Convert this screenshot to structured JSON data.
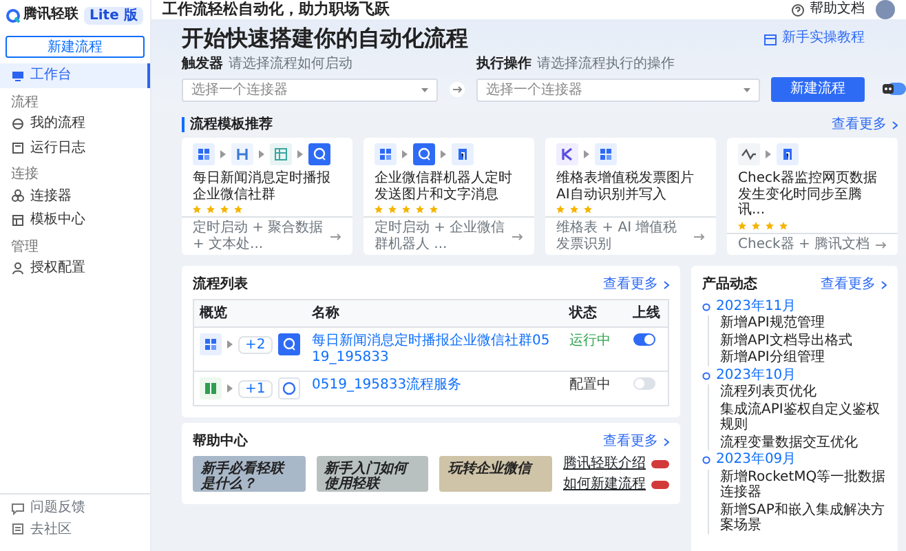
{
  "sidebar": {
    "logo": "腾讯轻联",
    "edition": "Lite 版",
    "new_button": "新建流程",
    "items": [
      {
        "kind": "item",
        "label": "工作台",
        "selected": true
      },
      {
        "kind": "section",
        "label": "流程"
      },
      {
        "kind": "item",
        "label": "我的流程",
        "selected": false
      },
      {
        "kind": "item",
        "label": "运行日志",
        "selected": false
      },
      {
        "kind": "section",
        "label": "连接"
      },
      {
        "kind": "item",
        "label": "连接器",
        "selected": false
      },
      {
        "kind": "item",
        "label": "模板中心",
        "selected": false
      },
      {
        "kind": "section",
        "label": "管理"
      },
      {
        "kind": "item",
        "label": "授权配置",
        "selected": false
      }
    ],
    "footer": [
      {
        "label": "问题反馈"
      },
      {
        "label": "去社区"
      }
    ]
  },
  "header": {
    "slogan": "工作流轻松自动化，助力职场飞跃",
    "help": "帮助文档"
  },
  "hero": {
    "title": "开始快速搭建你的自动化流程",
    "tutorial": "新手实操教程",
    "trigger": {
      "label": "触发器",
      "hint": "请选择流程如何启动",
      "placeholder": "选择一个连接器"
    },
    "action": {
      "label": "执行操作",
      "hint": "请选择流程执行的操作",
      "placeholder": "选择一个连接器"
    },
    "create_button": "新建流程"
  },
  "templates": {
    "title": "流程模板推荐",
    "more": "查看更多",
    "cards": [
      {
        "icons": [
          {
            "kind": "grid"
          },
          {
            "kind": "hbar"
          },
          {
            "kind": "table"
          },
          {
            "kind": "chat"
          }
        ],
        "title": "每日新闻消息定时播报企业微信社群",
        "stars": 4,
        "tags": "定时启动 + 聚合数据 + 文本处..."
      },
      {
        "icons": [
          {
            "kind": "grid"
          },
          {
            "kind": "chat"
          },
          {
            "kind": "doc"
          }
        ],
        "title": "企业微信群机器人定时发送图片和文字消息",
        "stars": 5,
        "tags": "定时启动 + 企业微信群机器人 ..."
      },
      {
        "icons": [
          {
            "kind": "kbar"
          },
          {
            "kind": "grid"
          }
        ],
        "title": "维格表增值税发票图片AI自动识别并写入",
        "stars": 3,
        "tags": "维格表 + AI 增值税发票识别"
      },
      {
        "icons": [
          {
            "kind": "wave"
          },
          {
            "kind": "doc"
          }
        ],
        "title": "Check器监控网页数据发生变化时同步至腾讯...",
        "stars": 4,
        "tags": "Check器 + 腾讯文档"
      }
    ]
  },
  "flows": {
    "title": "流程列表",
    "more": "查看更多",
    "columns": [
      "概览",
      "名称",
      "状态",
      "上线"
    ],
    "rows": [
      {
        "icons": [
          {
            "kind": "grid"
          },
          {
            "kind": "chat"
          }
        ],
        "extra": "+2",
        "name": "每日新闻消息定时播报企业微信社群0519_195833",
        "status": "运行中",
        "color": "#2ea44f",
        "online": true
      },
      {
        "icons": [
          {
            "kind": "sheet"
          },
          {
            "kind": "bubble"
          }
        ],
        "extra": "+1",
        "name": "0519_195833流程服务",
        "status": "配置中",
        "color": "#333333",
        "online": false
      }
    ]
  },
  "news": {
    "title": "产品动态",
    "more": "查看更多",
    "groups": [
      {
        "month": "2023年11月",
        "items": [
          "新增API规范管理",
          "新增API文档导出格式",
          "新增API分组管理"
        ]
      },
      {
        "month": "2023年10月",
        "items": [
          "流程列表页优化",
          "集成流API鉴权自定义鉴权规则",
          "流程变量数据交互优化"
        ]
      },
      {
        "month": "2023年09月",
        "items": [
          "新增RocketMQ等一批数据连接器",
          "新增SAP和嵌入集成解决方案场景"
        ]
      }
    ]
  },
  "help": {
    "title": "帮助中心",
    "more": "查看更多",
    "banners": [
      {
        "label": "新手必看轻联是什么？",
        "color": "#a9b8c9"
      },
      {
        "label": "新手入门如何使用轻联",
        "color": "#b9c1c0"
      },
      {
        "label": "玩转企业微信",
        "color": "#cfc3a8"
      }
    ],
    "links": [
      {
        "label": "腾讯轻联介绍"
      },
      {
        "label": "如何新建流程"
      }
    ]
  }
}
